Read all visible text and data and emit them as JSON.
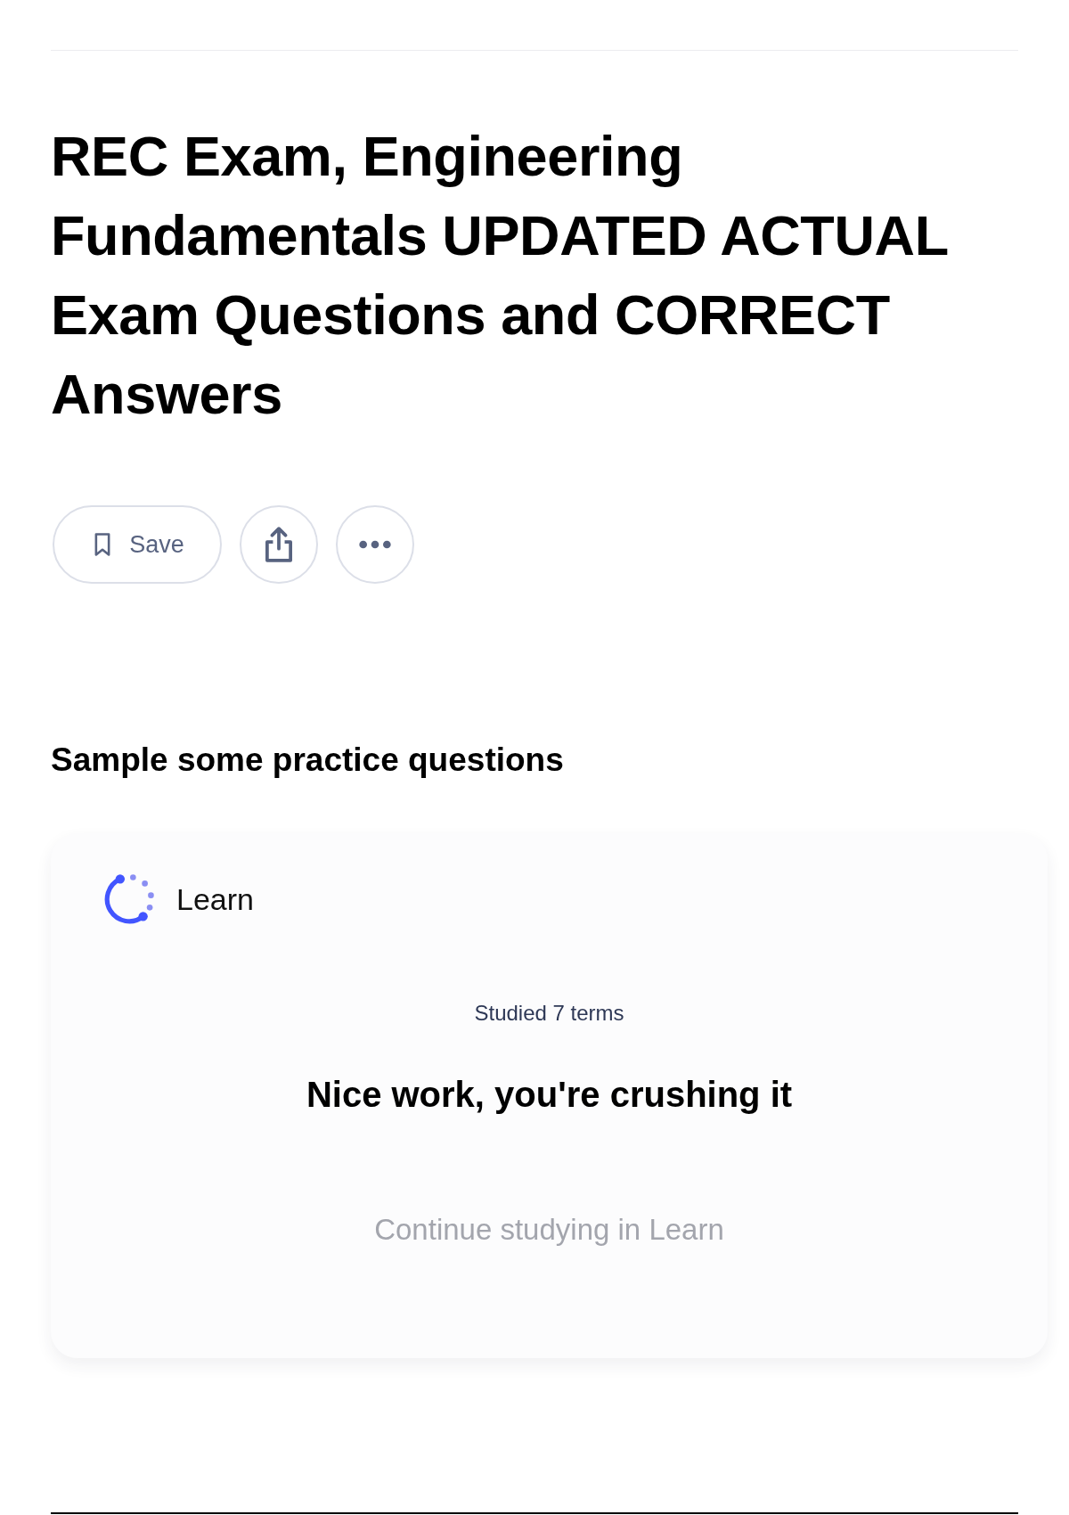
{
  "title": "REC Exam, Engineering Fundamentals UPDATED ACTUAL Exam Questions and CORRECT Answers",
  "actions": [
    {
      "kind": "save",
      "label": "Save"
    },
    {
      "kind": "share"
    },
    {
      "kind": "more"
    }
  ],
  "practice": {
    "heading": "Sample some practice questions",
    "card": {
      "mode": "Learn",
      "progress": "Studied 7 terms",
      "message": "Nice work, you're crushing it",
      "link": "Continue studying in Learn"
    }
  }
}
